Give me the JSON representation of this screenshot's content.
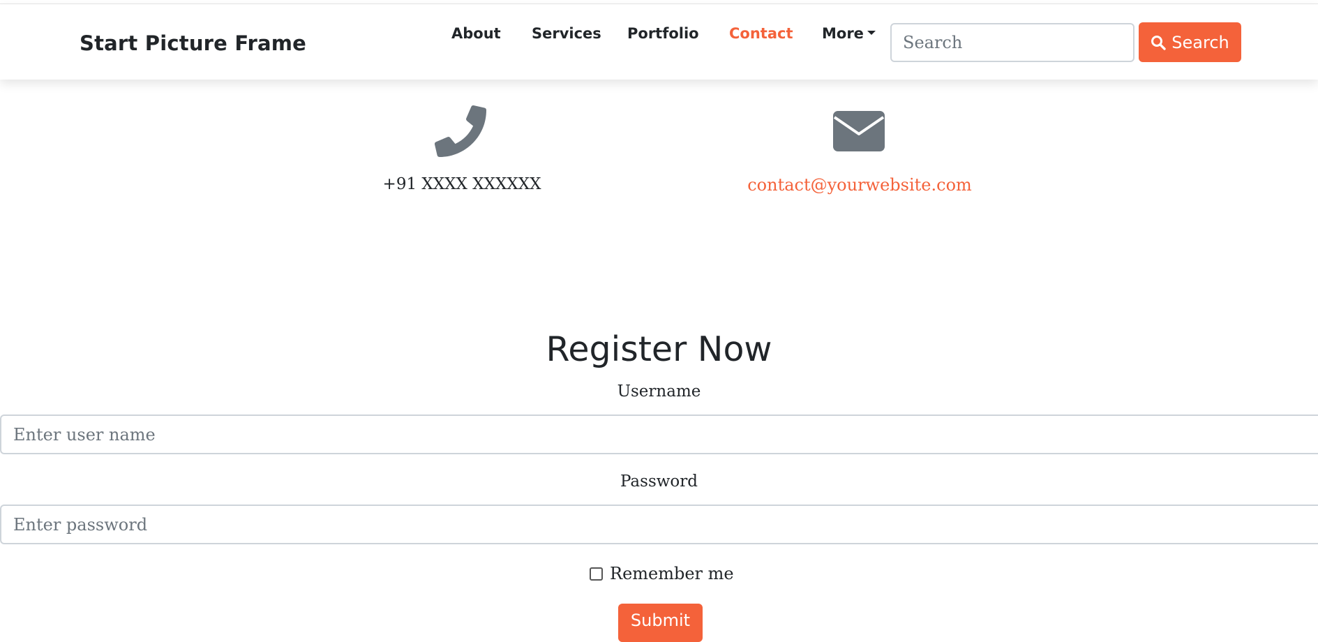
{
  "navbar": {
    "brand": "Start Picture Frame",
    "links": [
      {
        "label": "About",
        "active": false
      },
      {
        "label": "Services",
        "active": false
      },
      {
        "label": "Portfolio",
        "active": false
      },
      {
        "label": "Contact",
        "active": true
      },
      {
        "label": "More",
        "active": false,
        "dropdown": true
      }
    ],
    "search": {
      "placeholder": "Search",
      "value": "",
      "button_label": "Search"
    }
  },
  "contact": {
    "phone": "+91 XXXX XXXXXX",
    "email": "contact@yourwebsite.com",
    "icons": [
      "phone-icon",
      "envelope-icon"
    ]
  },
  "register": {
    "title": "Register Now",
    "username_label": "Username",
    "username_placeholder": "Enter user name",
    "password_label": "Password",
    "password_placeholder": "Enter password",
    "remember_label": "Remember me",
    "remember_checked": false,
    "submit_label": "Submit"
  },
  "colors": {
    "accent": "#f4623a",
    "text": "#212529",
    "icon_gray": "#6c757d",
    "input_border": "#ced4da"
  }
}
